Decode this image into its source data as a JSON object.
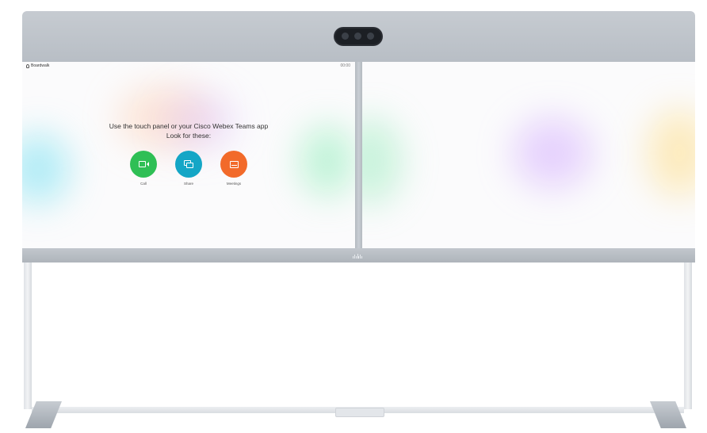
{
  "device": {
    "room_name": "Boardwalk",
    "time": "00:00"
  },
  "screen_left": {
    "instruction_line1": "Use the touch panel or your Cisco Webex Teams app",
    "instruction_line2": "Look for these:",
    "actions": [
      {
        "label": "Call",
        "icon": "camera-icon",
        "color": "#2fbf55"
      },
      {
        "label": "Share",
        "icon": "share-screen-icon",
        "color": "#14a6c6"
      },
      {
        "label": "Meetings",
        "icon": "meetings-icon",
        "color": "#f26a2a"
      }
    ]
  }
}
